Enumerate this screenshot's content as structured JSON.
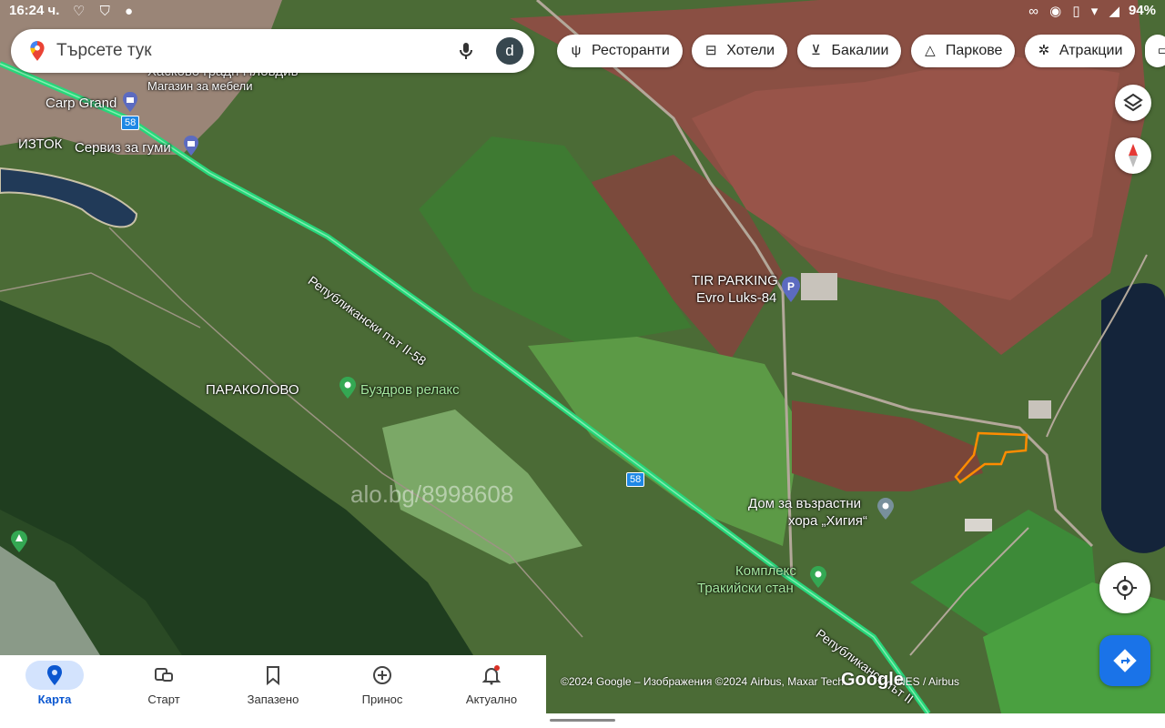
{
  "status_bar": {
    "time": "16:24 ч.",
    "battery": "94%"
  },
  "search": {
    "placeholder": "Търсете тук",
    "avatar_letter": "d"
  },
  "chips": [
    {
      "label": "Ресторанти",
      "icon": "fork-knife-icon"
    },
    {
      "label": "Хотели",
      "icon": "bed-icon"
    },
    {
      "label": "Бакалии",
      "icon": "cart-icon"
    },
    {
      "label": "Паркове",
      "icon": "tree-icon"
    },
    {
      "label": "Атракции",
      "icon": "attraction-icon"
    }
  ],
  "map_labels": {
    "city_top": "Хасково градн Пловдив",
    "furniture": "Магазин за мебели",
    "carp": "Carp Grand",
    "iztok": "ИЗТОК",
    "tyres": "Сервиз за гуми",
    "road_name": "Републикански път II-58",
    "road_number": "58",
    "tir": "TIR PARKING",
    "evro": "Evro Luks-84",
    "paracolovo": "ПАРАКОЛОВО",
    "buzdrov": "Буздров релакс",
    "watermark": "alo.bg/8998608",
    "home_line1": "Дом за възрастни",
    "home_line2": "хора „Хигия“",
    "complex_line1": "Комплекс",
    "complex_line2": "Тракийски стан",
    "road_name_bottom": "Републиканск път II"
  },
  "attribution": "©2024 Google – Изображения ©2024 Airbus, Maxar Tech",
  "attribution_tail": "NES / Airbus",
  "google_logo": "Google",
  "nav": [
    {
      "label": "Карта",
      "icon": "map-pin-icon",
      "active": true
    },
    {
      "label": "Старт",
      "icon": "commute-icon",
      "active": false
    },
    {
      "label": "Запазено",
      "icon": "bookmark-icon",
      "active": false
    },
    {
      "label": "Принос",
      "icon": "add-circle-icon",
      "active": false
    },
    {
      "label": "Актуално",
      "icon": "bell-icon",
      "active": false
    }
  ],
  "colors": {
    "accent": "#1a73e8",
    "road": "#28d67a",
    "parcel": "#ff8c00"
  }
}
